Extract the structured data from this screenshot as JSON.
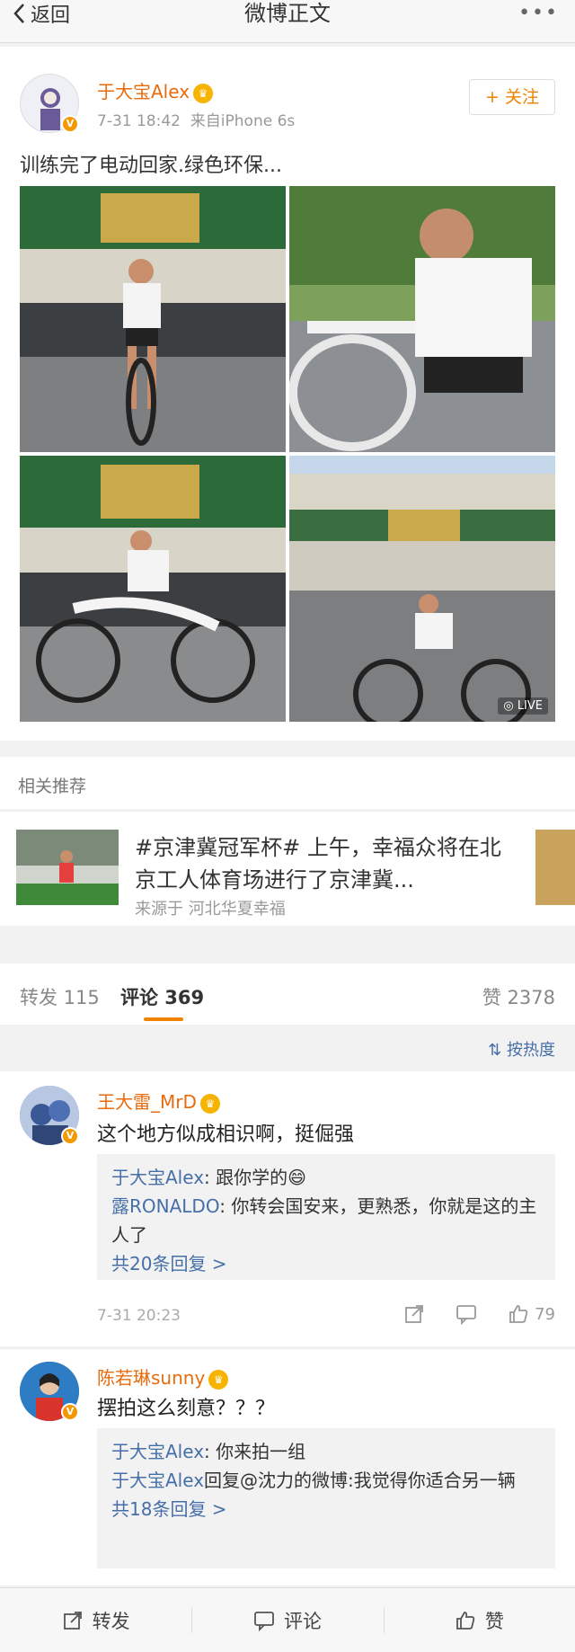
{
  "nav": {
    "back_label": "返回",
    "title": "微博正文",
    "more": "•••"
  },
  "post": {
    "author": "于大宝Alex",
    "time": "7-31 18:42",
    "source": "来自iPhone 6s",
    "follow_label": "+ 关注",
    "text": "训练完了电动回家.绿色环保...",
    "live_badge": "LIVE"
  },
  "related": {
    "header": "相关推荐",
    "title": "#京津冀冠军杯# 上午，幸福众将在北京工人体育场进行了京津冀...",
    "source": "来源于 河北华夏幸福"
  },
  "tabs": {
    "repost": "转发 115",
    "comment": "评论 369",
    "like": "赞 2378"
  },
  "sort_label": "按热度",
  "comments": [
    {
      "name": "王大雷_MrD",
      "text": "这个地方似成相识啊，挺倔强",
      "replies": [
        {
          "user": "于大宝Alex",
          "text": ": 跟你学的😄"
        },
        {
          "user": "露RONALDO",
          "text": ": 你转会国安来，更熟悉，你就是这的主人了"
        }
      ],
      "more": "共20条回复 >",
      "time": "7-31 20:23",
      "likes": "79"
    },
    {
      "name": "陈若琳sunny",
      "text": "摆拍这么刻意？？？",
      "replies": [
        {
          "user": "于大宝Alex",
          "text": ": 你来拍一组"
        },
        {
          "user": "于大宝Alex",
          "text": "回复@沈力的微博:我觉得你适合另一辆"
        }
      ],
      "more": "共18条回复 >"
    }
  ],
  "bottom": {
    "repost": "转发",
    "comment": "评论",
    "like": "赞"
  },
  "colors": {
    "accent": "#f08200",
    "username": "#e86b0c",
    "link": "#466fa8",
    "background": "#f2f2f2"
  }
}
